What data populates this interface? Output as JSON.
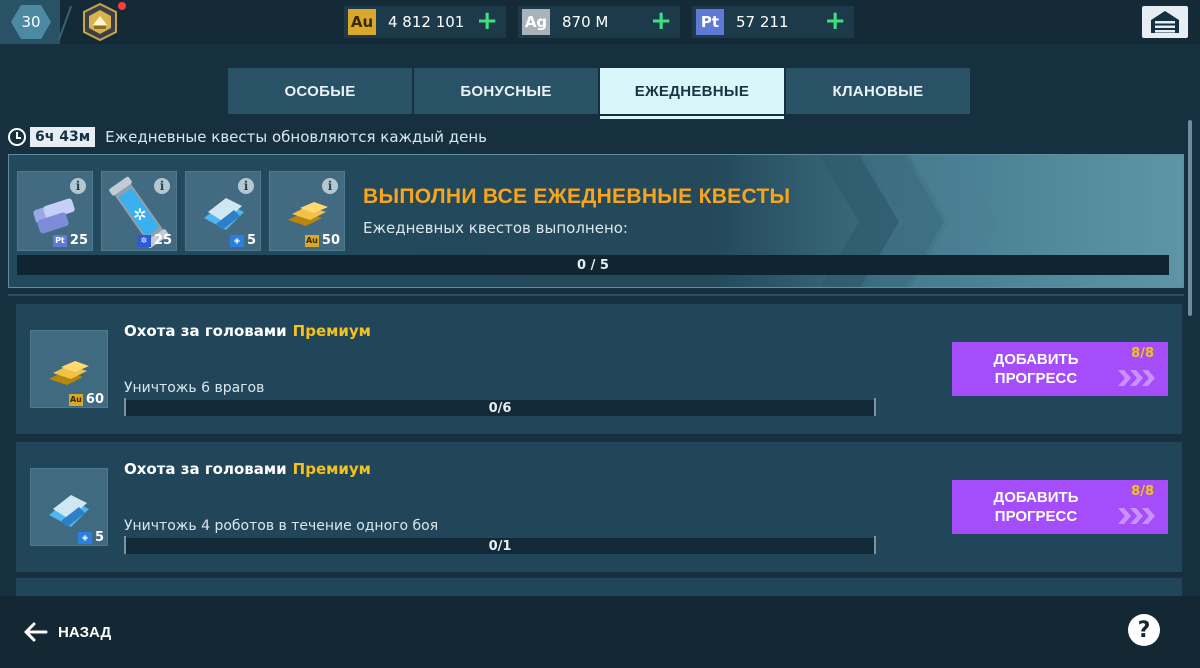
{
  "topbar": {
    "level": "30",
    "currencies": [
      {
        "symbol": "Au",
        "amount": "4 812 101",
        "color": "#d7a82a"
      },
      {
        "symbol": "Ag",
        "amount": "870 M",
        "color": "#a9b4ba"
      },
      {
        "symbol": "Pt",
        "amount": "57 211",
        "color": "#5f79d6"
      }
    ],
    "plus_glyph": "+"
  },
  "tabs": [
    {
      "label": "ОСОБЫЕ",
      "active": false
    },
    {
      "label": "БОНУСНЫЕ",
      "active": false
    },
    {
      "label": "ЕЖЕДНЕВНЫЕ",
      "active": true
    },
    {
      "label": "КЛАНОВЫЕ",
      "active": false
    }
  ],
  "timer": {
    "value": "6ч 43м",
    "text": "Ежедневные квесты обновляются каждый день"
  },
  "main_quest": {
    "title": "ВЫПОЛНИ ВСЕ ЕЖЕДНЕВНЫЕ КВЕСТЫ",
    "subtitle": "Ежедневных квестов выполнено:",
    "progress_label": "0 / 5",
    "progress": 0,
    "rewards": [
      {
        "icon": "platinum-stack-icon",
        "tag": "Pt",
        "count": "25"
      },
      {
        "icon": "energy-canister-icon",
        "tag": "✲",
        "count": "25"
      },
      {
        "icon": "key-card-icon",
        "tag": "◈",
        "count": "5"
      },
      {
        "icon": "gold-bars-icon",
        "tag": "Au",
        "count": "50"
      }
    ],
    "info_glyph": "i"
  },
  "quests": [
    {
      "title": "Охота за головами",
      "premium": "Премиум",
      "description": "Уничтожь 6 врагов",
      "progress_label": "0/6",
      "reward_icon": "gold-bars-icon",
      "reward_tag": "Au",
      "reward_count": "60",
      "button_label": "ДОБАВИТЬ ПРОГРЕСС",
      "button_counter": "8/8"
    },
    {
      "title": "Охота за головами",
      "premium": "Премиум",
      "description": "Уничтожь 4 роботов в течение одного боя",
      "progress_label": "0/1",
      "reward_icon": "key-card-icon",
      "reward_tag": "◈",
      "reward_count": "5",
      "button_label": "ДОБАВИТЬ ПРОГРЕСС",
      "button_counter": "8/8"
    }
  ],
  "bottombar": {
    "back_label": "НАЗАД",
    "help_glyph": "?"
  },
  "colors": {
    "accent_purple": "#a64dfb",
    "title_orange": "#f7a51e",
    "premium_yellow": "#f4c21a",
    "plus_green": "#3fe083"
  }
}
